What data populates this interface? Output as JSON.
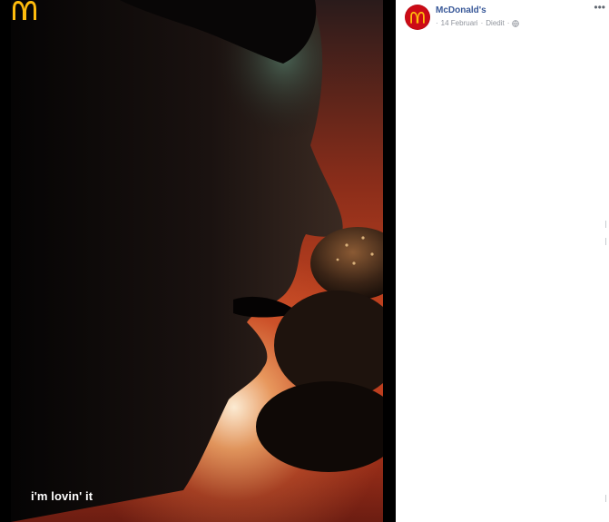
{
  "ad": {
    "tagline": "i'm lovin' it",
    "logo": "mcdonalds-golden-arches"
  },
  "post": {
    "page_name": "McDonald's",
    "date": "14 Februari",
    "separator": "·",
    "edited_label": "Diedit",
    "privacy_icon": "globe-icon",
    "more_icon": "ellipsis-icon"
  },
  "colors": {
    "brand_red": "#cc0b16",
    "arches_yellow": "#ffbc0d",
    "link_blue": "#385898",
    "meta_gray": "#90949c"
  }
}
